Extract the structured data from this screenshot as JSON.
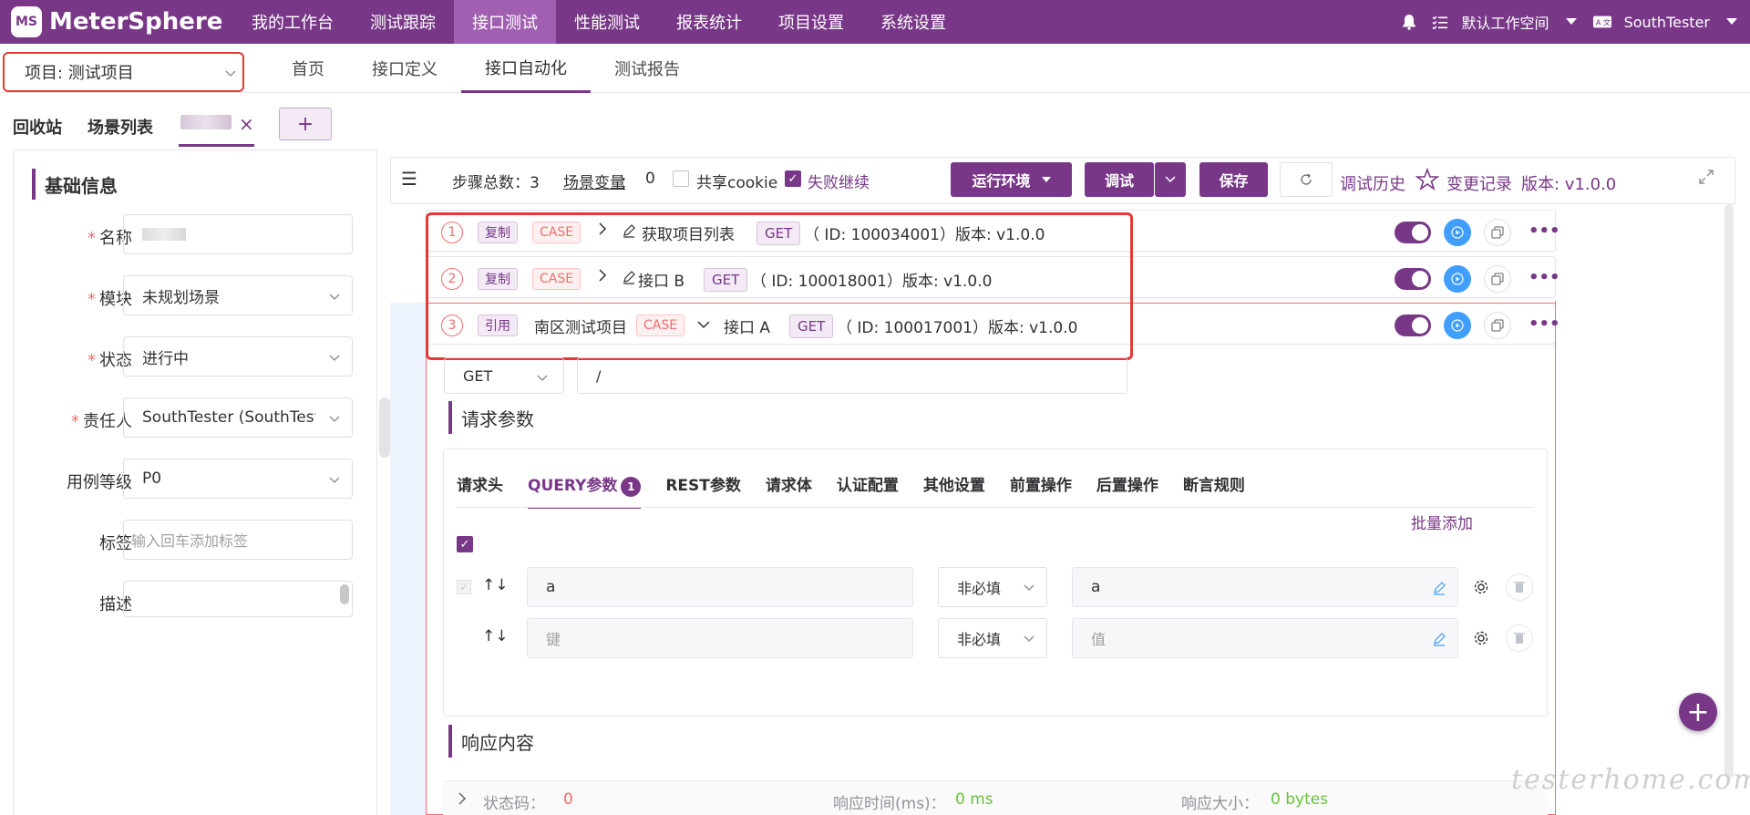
{
  "brand": {
    "name": "MeterSphere",
    "mark": "MS"
  },
  "topnav": {
    "items": [
      "我的工作台",
      "测试跟踪",
      "接口测试",
      "性能测试",
      "报表统计",
      "项目设置",
      "系统设置"
    ],
    "active_index": 2
  },
  "topright": {
    "workspace": "默认工作空间",
    "user": "SouthTester"
  },
  "project": {
    "label": "项目: 测试项目"
  },
  "subnav": {
    "items": [
      "首页",
      "接口定义",
      "接口自动化",
      "测试报告"
    ],
    "active_index": 2
  },
  "scenario_tabs": {
    "recycle": "回收站",
    "list": "场景列表",
    "close": "×",
    "add": "+"
  },
  "basic_info": {
    "title": "基础信息",
    "fields": [
      {
        "label": "名称",
        "required": true,
        "value": ""
      },
      {
        "label": "模块",
        "required": true,
        "value": "未规划场景"
      },
      {
        "label": "状态",
        "required": true,
        "value": "进行中"
      },
      {
        "label": "责任人",
        "required": true,
        "value": "SouthTester (SouthTester)"
      },
      {
        "label": "用例等级",
        "required": false,
        "value": "P0"
      },
      {
        "label": "标签",
        "required": false,
        "placeholder": "输入回车添加标签"
      },
      {
        "label": "描述",
        "required": false,
        "value": ""
      }
    ]
  },
  "toolbar": {
    "steps_total_label": "步骤总数：",
    "steps_total": "3",
    "scene_var_label": "场景变量",
    "scene_var_sep": "：",
    "scene_var_count": "0",
    "share_cookie": "共享cookie",
    "share_cookie_checked": false,
    "fail_continue": "失败继续",
    "fail_continue_checked": true,
    "run_env": "运行环境",
    "debug": "调试",
    "save": "保存",
    "debug_history": "调试历史",
    "change_log": "变更记录",
    "version": "版本: v1.0.0"
  },
  "steps": [
    {
      "index": "1",
      "type": "复制",
      "case": "CASE",
      "name": "获取项目列表",
      "method": "GET",
      "meta": "（ ID: 100034001）版本: v1.0.0",
      "enabled": true
    },
    {
      "index": "2",
      "type": "复制",
      "case": "CASE",
      "name": "接口 B",
      "method": "GET",
      "meta": "（ ID: 100018001）版本: v1.0.0",
      "enabled": true
    },
    {
      "index": "3",
      "type": "引用",
      "project": "南区测试项目",
      "case": "CASE",
      "name": "接口 A",
      "method": "GET",
      "meta": "（ ID: 100017001）版本: v1.0.0",
      "enabled": true
    }
  ],
  "request": {
    "method": "GET",
    "path": "/",
    "params_title": "请求参数",
    "tabs": [
      "请求头",
      "QUERY参数",
      "REST参数",
      "请求体",
      "认证配置",
      "其他设置",
      "前置操作",
      "后置操作",
      "断言规则"
    ],
    "active_tab": 1,
    "query_count": "1",
    "batch_add": "批量添加",
    "rows": [
      {
        "key": "a",
        "required": "非必填",
        "value": "a"
      },
      {
        "key_placeholder": "键",
        "required": "非必填",
        "value_placeholder": "值"
      }
    ]
  },
  "response": {
    "title": "响应内容",
    "status_label": "状态码：",
    "status_value": "0",
    "time_label": "响应时间(ms)：",
    "time_value": "0 ms",
    "size_label": "响应大小：",
    "size_value": "0 bytes"
  },
  "watermark": "testerhome.com",
  "colors": {
    "primary": "#783887",
    "danger": "#f56c6c",
    "success": "#67c23a",
    "info_blue": "#409eff"
  }
}
